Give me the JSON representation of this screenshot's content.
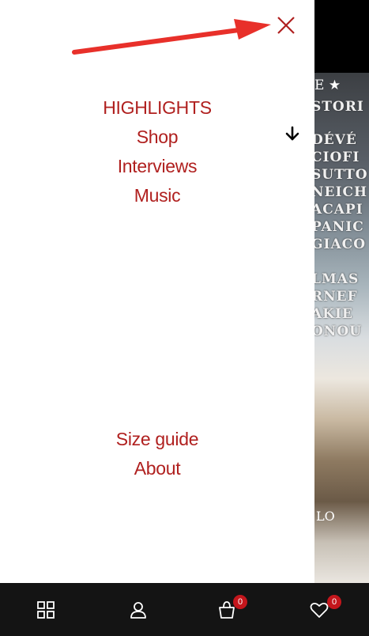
{
  "background_page": {
    "header_fragment": "E ★",
    "title_lines": [
      "STORI",
      "DÉVÉ",
      "CIOFI",
      "SUTTO",
      "NEICH",
      "ACAPI",
      "PANIC",
      "GIACO",
      "",
      "LMAS",
      "RNEF",
      "AKIE",
      "ONOU"
    ],
    "footer_fragment": "LO"
  },
  "drawer": {
    "close_icon": "close-icon",
    "menu_top": [
      {
        "label": "HIGHLIGHTS"
      },
      {
        "label": "Shop"
      },
      {
        "label": "Interviews"
      },
      {
        "label": "Music"
      }
    ],
    "menu_bottom": [
      {
        "label": "Size guide"
      },
      {
        "label": "About"
      }
    ]
  },
  "annotation": {
    "arrow_color": "#e8302a"
  },
  "colors": {
    "accent": "#b0201f",
    "badge": "#c4161c",
    "bottombar": "#141414"
  },
  "bottom_bar": {
    "items": [
      {
        "icon": "grid-icon"
      },
      {
        "icon": "user-icon"
      },
      {
        "icon": "cart-icon",
        "badge": "0"
      },
      {
        "icon": "heart-icon",
        "badge": "0"
      }
    ]
  }
}
